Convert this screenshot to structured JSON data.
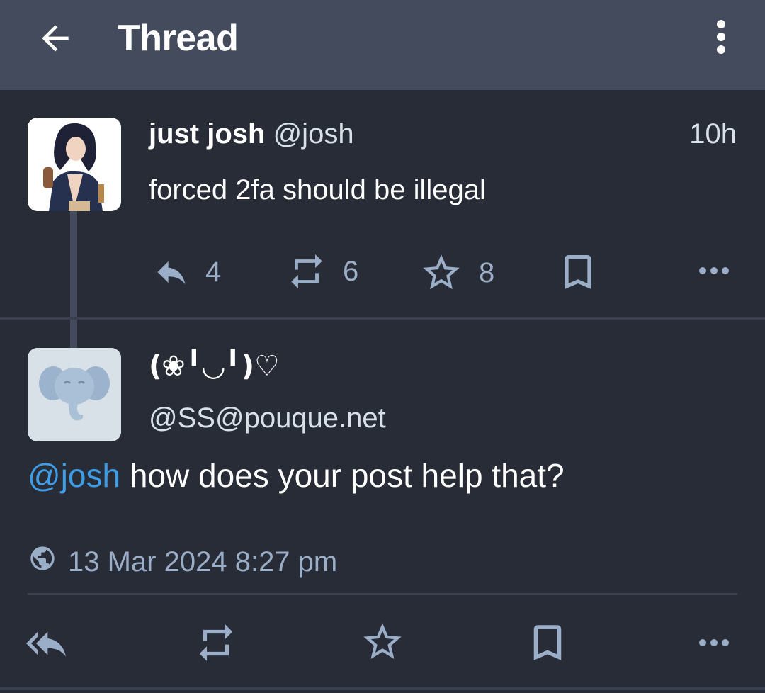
{
  "appbar": {
    "title": "Thread",
    "back_icon": "arrow-left-icon",
    "menu_icon": "more-vertical-icon"
  },
  "status": {
    "display_name": "just josh",
    "handle": "@josh",
    "relative_time": "10h",
    "content": "forced 2fa should be illegal",
    "actions": {
      "reply": {
        "icon": "reply-icon",
        "count": "4"
      },
      "boost": {
        "icon": "boost-icon",
        "count": "6"
      },
      "favourite": {
        "icon": "star-icon",
        "count": "8"
      },
      "bookmark": {
        "icon": "bookmark-icon"
      },
      "more": {
        "icon": "more-horizontal-icon"
      }
    }
  },
  "reply": {
    "display_name": "(❀╹◡╹)♡",
    "handle": "@SS@pouque.net",
    "mention": "@josh",
    "content": " how does your post help that?",
    "visibility_icon": "globe-icon",
    "timestamp": "13 Mar 2024 8:27 pm",
    "actions": {
      "reply_all": {
        "icon": "reply-all-icon"
      },
      "boost": {
        "icon": "boost-icon"
      },
      "favourite": {
        "icon": "star-icon"
      },
      "bookmark": {
        "icon": "bookmark-icon"
      },
      "more": {
        "icon": "more-horizontal-icon"
      }
    }
  },
  "colors": {
    "background": "#282c37",
    "appbar": "#444b5d",
    "icon": "#9baec8",
    "mention": "#3f9de5",
    "text": "#ffffff",
    "secondary_text": "#d9e1e8"
  }
}
